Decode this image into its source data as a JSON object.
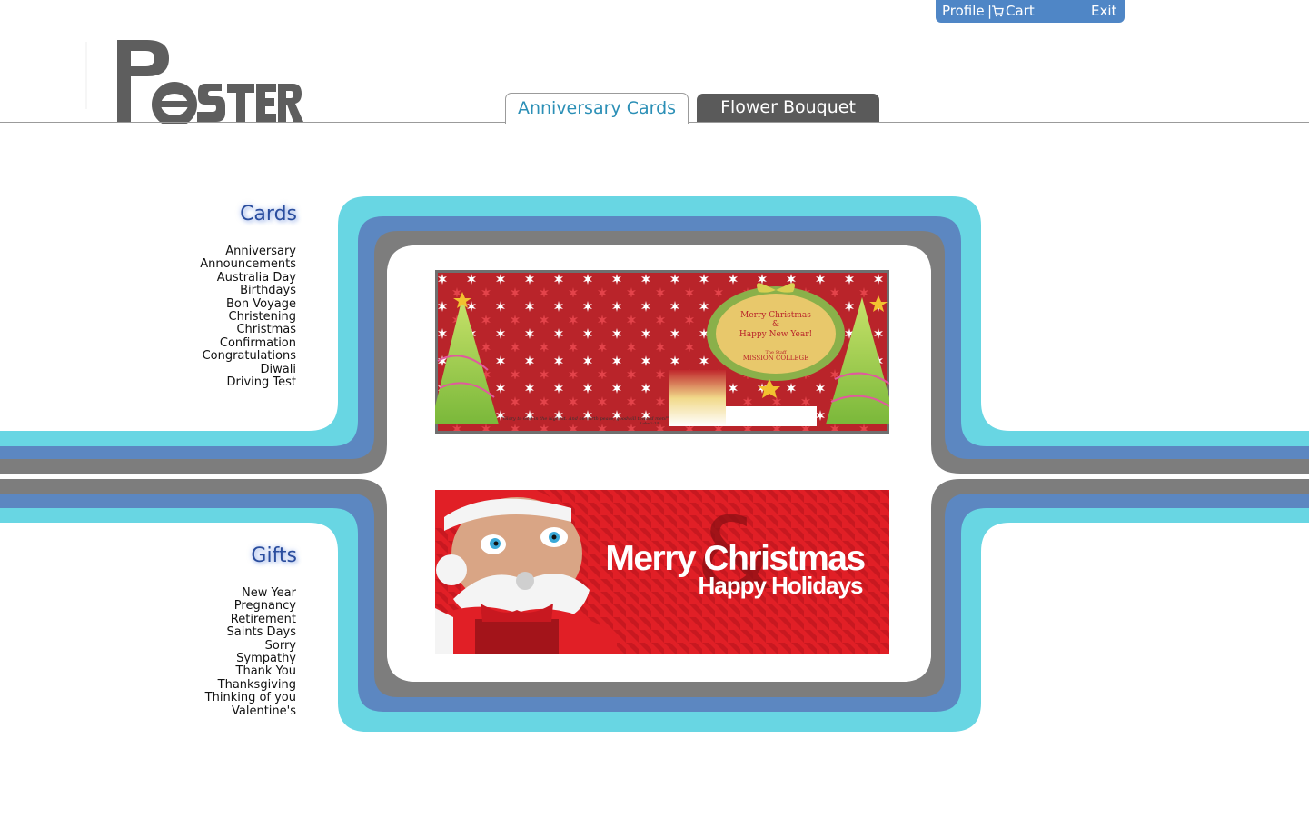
{
  "userbar": {
    "profile": "Profile",
    "separator": "|",
    "cart": "Cart",
    "cart_icon": "cart-icon",
    "exit": "Exit",
    "bg_color": "#4f86c6"
  },
  "logo": {
    "text": "POSTER"
  },
  "tabs": [
    {
      "label": "Anniversary Cards",
      "active": true
    },
    {
      "label": "Flower Bouquet",
      "active": false
    }
  ],
  "cards_menu": {
    "title": "Cards",
    "items": [
      "Anniversary",
      "Announcements",
      "Australia Day",
      "Birthdays",
      "Bon Voyage",
      "Christening",
      "Christmas",
      "Confirmation",
      "Congratulations",
      "Diwali",
      "Driving Test"
    ]
  },
  "gifts_menu": {
    "title": "Gifts",
    "items": [
      "New Year",
      "Pregnancy",
      "Retirement",
      "Saints Days",
      "Sorry",
      "Sympathy",
      "Thank You",
      "Thanksgiving",
      "Thinking of you",
      "Valentine's"
    ]
  },
  "banners": {
    "card1": {
      "heading_line1": "Merry Christmas",
      "ampersand": "&",
      "heading_line2": "Happy New Year!",
      "small": "The Staff",
      "org": "MISSION COLLEGE",
      "footer": "\"Glory to God in the highest. And on earth peace, goodwill toward men!\"",
      "verse": "Luke 2:14"
    },
    "card2": {
      "line1": "Merry Christmas",
      "line2": "Happy Holidays",
      "ampersand": "&"
    }
  },
  "colors": {
    "cyan": "#68d6e3",
    "blue": "#5c87c1",
    "gray": "#7d7d7d",
    "title_blue": "#2a4d9e",
    "tab_active_text": "#2b8fb6",
    "tab_inactive_bg": "#5a5a5a"
  }
}
